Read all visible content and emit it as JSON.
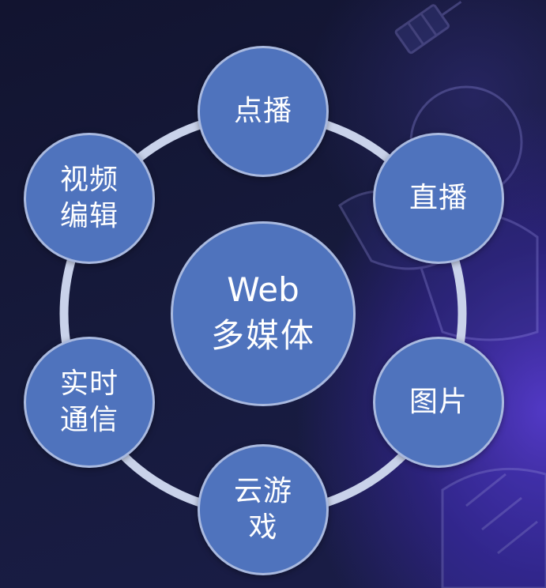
{
  "center": {
    "line1": "Web",
    "line2": "多媒体"
  },
  "nodes": [
    {
      "label": "点播"
    },
    {
      "label": "直播"
    },
    {
      "label": "图片"
    },
    {
      "label": "云游\n戏"
    },
    {
      "label": "实时\n通信"
    },
    {
      "label": "视频\n编辑"
    }
  ],
  "colors": {
    "node_fill": "#4f73bd",
    "node_border": "#a9b9df",
    "ring": "#c9d2ea",
    "background": "#141633",
    "accent_glow": "#5c3edc"
  }
}
